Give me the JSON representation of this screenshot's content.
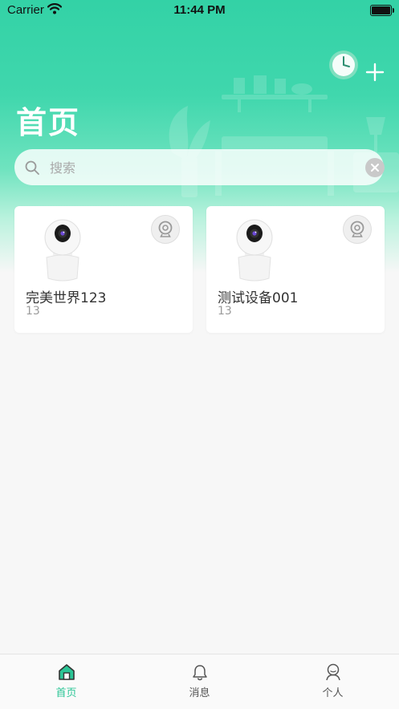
{
  "status_bar": {
    "carrier": "Carrier",
    "time": "11:44 PM"
  },
  "header": {
    "title": "首页"
  },
  "search": {
    "placeholder": "搜索",
    "value": ""
  },
  "devices": [
    {
      "name": "完美世界123",
      "sub": "13"
    },
    {
      "name": "测试设备001",
      "sub": "13"
    }
  ],
  "tabbar": {
    "items": [
      {
        "label": "首页",
        "icon": "home-icon",
        "active": true
      },
      {
        "label": "消息",
        "icon": "bell-icon",
        "active": false
      },
      {
        "label": "个人",
        "icon": "person-icon",
        "active": false
      }
    ]
  },
  "colors": {
    "accent": "#2cc596",
    "header_top": "#33d2a6",
    "background": "#f7f7f7"
  }
}
